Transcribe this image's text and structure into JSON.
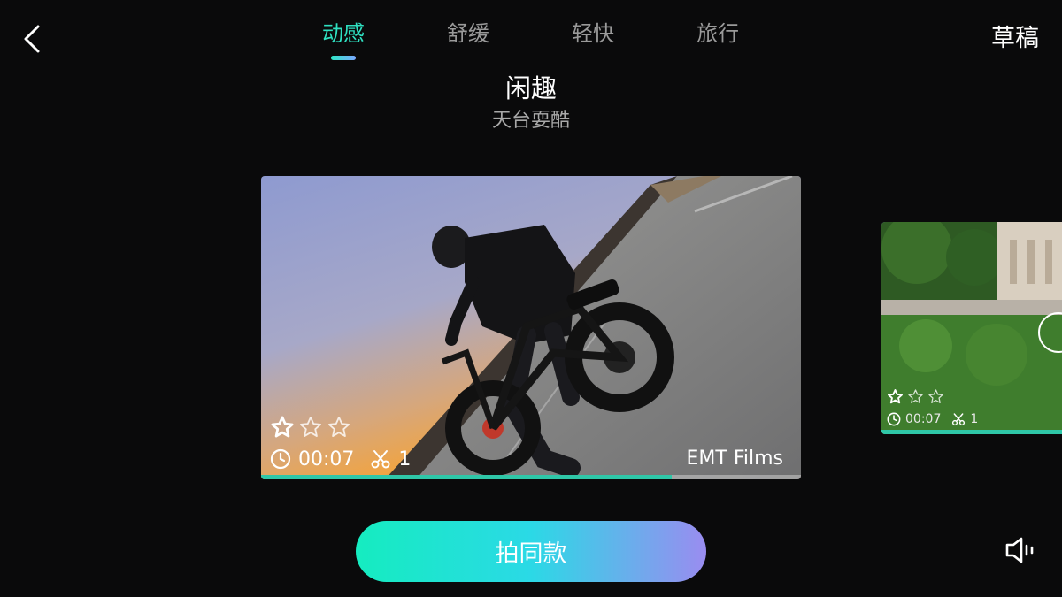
{
  "header": {
    "back_icon": "chevron-left-icon",
    "tabs": [
      {
        "label": "动感",
        "active": true
      },
      {
        "label": "舒缓",
        "active": false
      },
      {
        "label": "轻快",
        "active": false
      },
      {
        "label": "旅行",
        "active": false
      }
    ],
    "draft_label": "草稿"
  },
  "template": {
    "title": "闲趣",
    "subtitle": "天台耍酷"
  },
  "cards": [
    {
      "rating": 1,
      "rating_max": 3,
      "duration": "00:07",
      "clips": "1",
      "author": "EMT Films",
      "progress": 0.76
    },
    {
      "rating": 1,
      "rating_max": 3,
      "duration": "00:07",
      "clips": "1",
      "progress": 1.0
    }
  ],
  "cta": {
    "label": "拍同款"
  },
  "sound_icon": "speaker-icon",
  "colors": {
    "accent": "#2fe0c1",
    "background": "#0a0a0b",
    "progress": "#2fc7a8"
  }
}
